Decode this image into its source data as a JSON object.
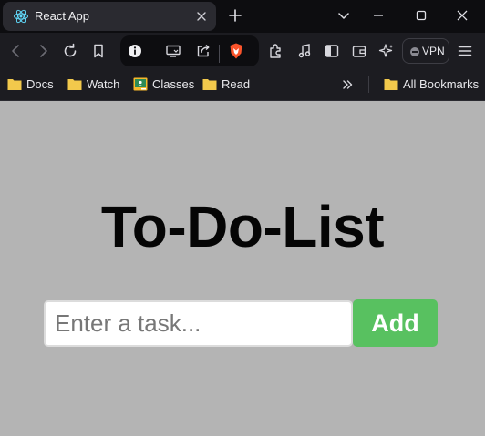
{
  "browser": {
    "tab": {
      "title": "React App",
      "favicon": "react-icon",
      "close_icon": "close-icon"
    },
    "new_tab_icon": "plus-icon",
    "window_controls": [
      "chevron-down-icon",
      "minimize-icon",
      "maximize-icon",
      "close-icon"
    ],
    "toolbar": {
      "nav_icons": [
        "back-icon",
        "forward-icon",
        "reload-icon",
        "bookmark-icon"
      ],
      "url_icons": [
        "info-icon",
        "cast-icon",
        "share-icon",
        "brave-shield-icon"
      ],
      "right_icons": [
        "extensions-icon",
        "media-icon",
        "sidebar-icon",
        "wallet-icon",
        "leo-icon"
      ],
      "vpn_label": "VPN",
      "menu_icon": "hamburger-menu-icon"
    },
    "bookmarks": {
      "items": [
        {
          "label": "Docs",
          "icon": "folder-icon"
        },
        {
          "label": "Watch",
          "icon": "folder-icon"
        },
        {
          "label": "Classes",
          "icon": "classroom-icon"
        },
        {
          "label": "Read",
          "icon": "folder-icon"
        }
      ],
      "overflow_icon": "double-chevron-right-icon",
      "all_bookmarks": {
        "label": "All Bookmarks",
        "icon": "folder-icon"
      }
    },
    "colors": {
      "tab_strip": "#0d0d10",
      "toolbar": "#1c1c21",
      "brave_orange": "#fb542b",
      "folder_yellow": "#f2c94c"
    }
  },
  "app": {
    "title": "To-Do-List",
    "input": {
      "placeholder": "Enter a task...",
      "value": ""
    },
    "add_button_label": "Add",
    "colors": {
      "background": "#b4b4b4",
      "button": "#58c160",
      "title": "#050505"
    }
  }
}
